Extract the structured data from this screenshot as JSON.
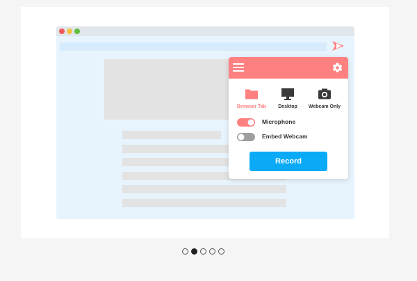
{
  "popup": {
    "modes": [
      {
        "label": "Browser Tab",
        "icon": "folder-icon",
        "active": true
      },
      {
        "label": "Desktop",
        "icon": "monitor-icon",
        "active": false
      },
      {
        "label": "Webcam Only",
        "icon": "camera-icon",
        "active": false
      }
    ],
    "toggles": [
      {
        "label": "Microphone",
        "on": true
      },
      {
        "label": "Embed Webcam",
        "on": false
      }
    ],
    "record_label": "Record"
  },
  "carousel": {
    "count": 5,
    "active_index": 1
  },
  "colors": {
    "accent": "#fe8081",
    "button": "#0aaaf6",
    "browser_bg": "#e8f4fd",
    "toggle_off": "#9e9e9e"
  }
}
